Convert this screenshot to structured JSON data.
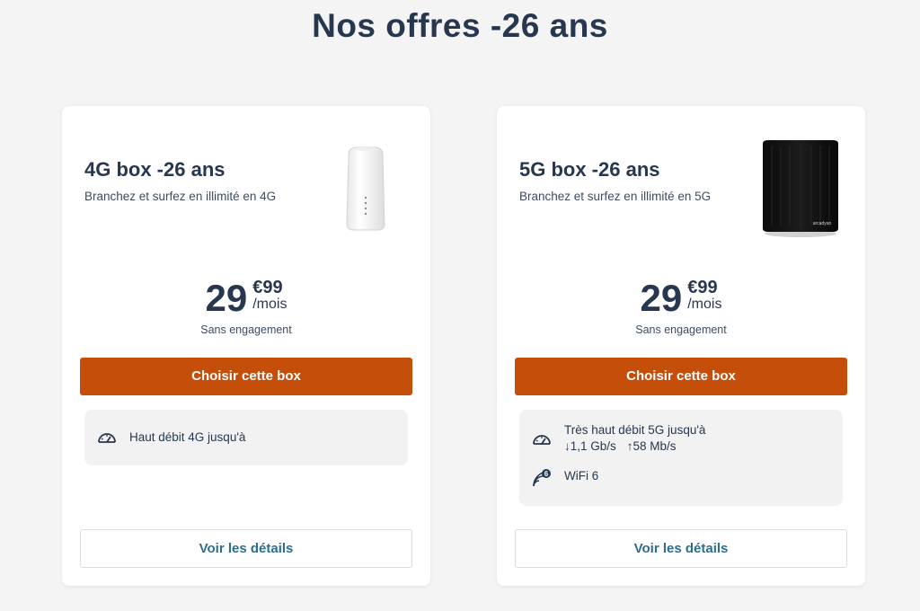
{
  "page": {
    "title": "Nos offres -26 ans"
  },
  "offers": [
    {
      "title": "4G box -26 ans",
      "description": "Branchez et surfez en illimité en 4G",
      "price_int": "29",
      "price_dec": "€99",
      "price_period": "/mois",
      "commitment": "Sans engagement",
      "cta": "Choisir cette box",
      "features": [
        {
          "icon": "speedometer-icon",
          "text": "Haut débit 4G jusqu'à"
        }
      ],
      "details": "Voir les détails"
    },
    {
      "title": "5G box -26 ans",
      "description": "Branchez et surfez en illimité en 5G",
      "price_int": "29",
      "price_dec": "€99",
      "price_period": "/mois",
      "commitment": "Sans engagement",
      "cta": "Choisir cette box",
      "features": [
        {
          "icon": "speedometer-icon",
          "text": "Très haut débit 5G jusqu'à",
          "down": "↓1,1 Gb/s",
          "up": "↑58 Mb/s"
        },
        {
          "icon": "wifi6-icon",
          "text": "WiFi 6"
        }
      ],
      "details": "Voir les détails",
      "device_brand": "arcadyan"
    }
  ],
  "colors": {
    "accent": "#c54e0a",
    "title": "#26374f",
    "link": "#2c6e8c",
    "background": "#f4f4f4"
  }
}
